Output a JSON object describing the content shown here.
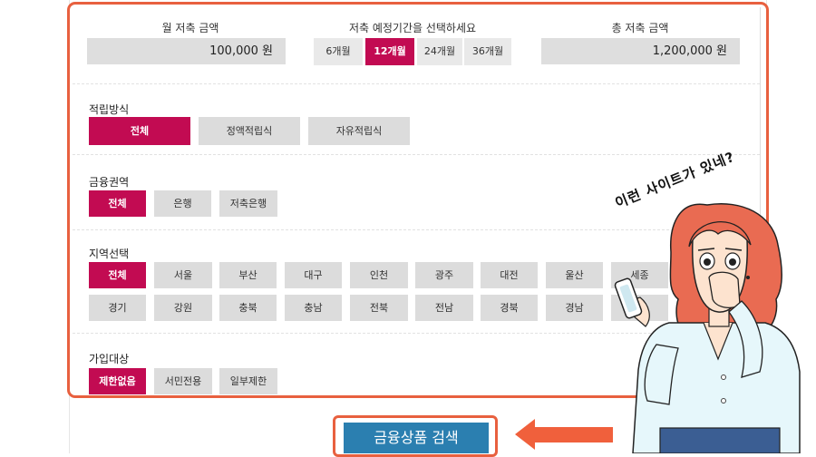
{
  "header": {
    "monthly_label": "월 저축 금액",
    "monthly_value": "100,000 원",
    "period_label": "저축 예정기간을 선택하세요",
    "periods": [
      {
        "label": "6개월",
        "selected": false
      },
      {
        "label": "12개월",
        "selected": true
      },
      {
        "label": "24개월",
        "selected": false
      },
      {
        "label": "36개월",
        "selected": false
      }
    ],
    "total_label": "총 저축 금액",
    "total_value": "1,200,000 원"
  },
  "savings_method": {
    "title": "적립방식",
    "options": [
      {
        "label": "전체",
        "selected": true
      },
      {
        "label": "정액적립식",
        "selected": false
      },
      {
        "label": "자유적립식",
        "selected": false
      }
    ]
  },
  "financial_sector": {
    "title": "금융권역",
    "options": [
      {
        "label": "전체",
        "selected": true
      },
      {
        "label": "은행",
        "selected": false
      },
      {
        "label": "저축은행",
        "selected": false
      }
    ]
  },
  "region": {
    "title": "지역선택",
    "row1": [
      {
        "label": "전체",
        "selected": true
      },
      {
        "label": "서울",
        "selected": false
      },
      {
        "label": "부산",
        "selected": false
      },
      {
        "label": "대구",
        "selected": false
      },
      {
        "label": "인천",
        "selected": false
      },
      {
        "label": "광주",
        "selected": false
      },
      {
        "label": "대전",
        "selected": false
      },
      {
        "label": "울산",
        "selected": false
      },
      {
        "label": "세종",
        "selected": false
      }
    ],
    "row2": [
      {
        "label": "경기",
        "selected": false
      },
      {
        "label": "강원",
        "selected": false
      },
      {
        "label": "충북",
        "selected": false
      },
      {
        "label": "충남",
        "selected": false
      },
      {
        "label": "전북",
        "selected": false
      },
      {
        "label": "전남",
        "selected": false
      },
      {
        "label": "경북",
        "selected": false
      },
      {
        "label": "경남",
        "selected": false
      }
    ]
  },
  "eligibility": {
    "title": "가입대상",
    "options": [
      {
        "label": "제한없음",
        "selected": true
      },
      {
        "label": "서민전용",
        "selected": false
      },
      {
        "label": "일부제한",
        "selected": false
      }
    ]
  },
  "search_button": "금융상품 검색",
  "annotation_text": "이런 사이트가 있네?",
  "colors": {
    "selected": "#c20b52",
    "unselected": "#dcdcdc",
    "highlight_border": "#e8603f",
    "search_button": "#2b7fb0",
    "arrow": "#f0603c"
  }
}
